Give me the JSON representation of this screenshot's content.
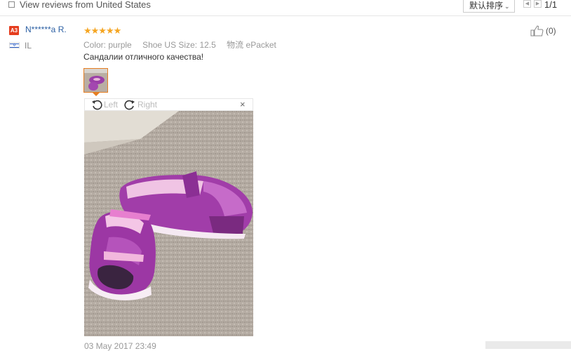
{
  "filter": {
    "label": "View reviews from United States",
    "checked": false
  },
  "sort": {
    "label": "默认排序"
  },
  "pager": {
    "text": "1/1"
  },
  "review": {
    "badge": "A3",
    "username": "N******a R.",
    "country": "IL",
    "rating": 5,
    "stars_text": "★★★★★",
    "attributes": [
      {
        "key": "Color:",
        "value": "purple"
      },
      {
        "key": "Shoe US Size:",
        "value": "12.5"
      },
      {
        "key": "物流",
        "value": "ePacket"
      }
    ],
    "text": "Сандалии отличного качества!",
    "helpful_count": "(0)",
    "date": "03 May 2017 23:49"
  },
  "viewer": {
    "rotate_left": "Left",
    "rotate_right": "Right",
    "close": "×"
  },
  "colors": {
    "accent_orange": "#e67e22",
    "star": "#f5a623",
    "link": "#2b5fa3",
    "badge": "#e53d1f"
  }
}
